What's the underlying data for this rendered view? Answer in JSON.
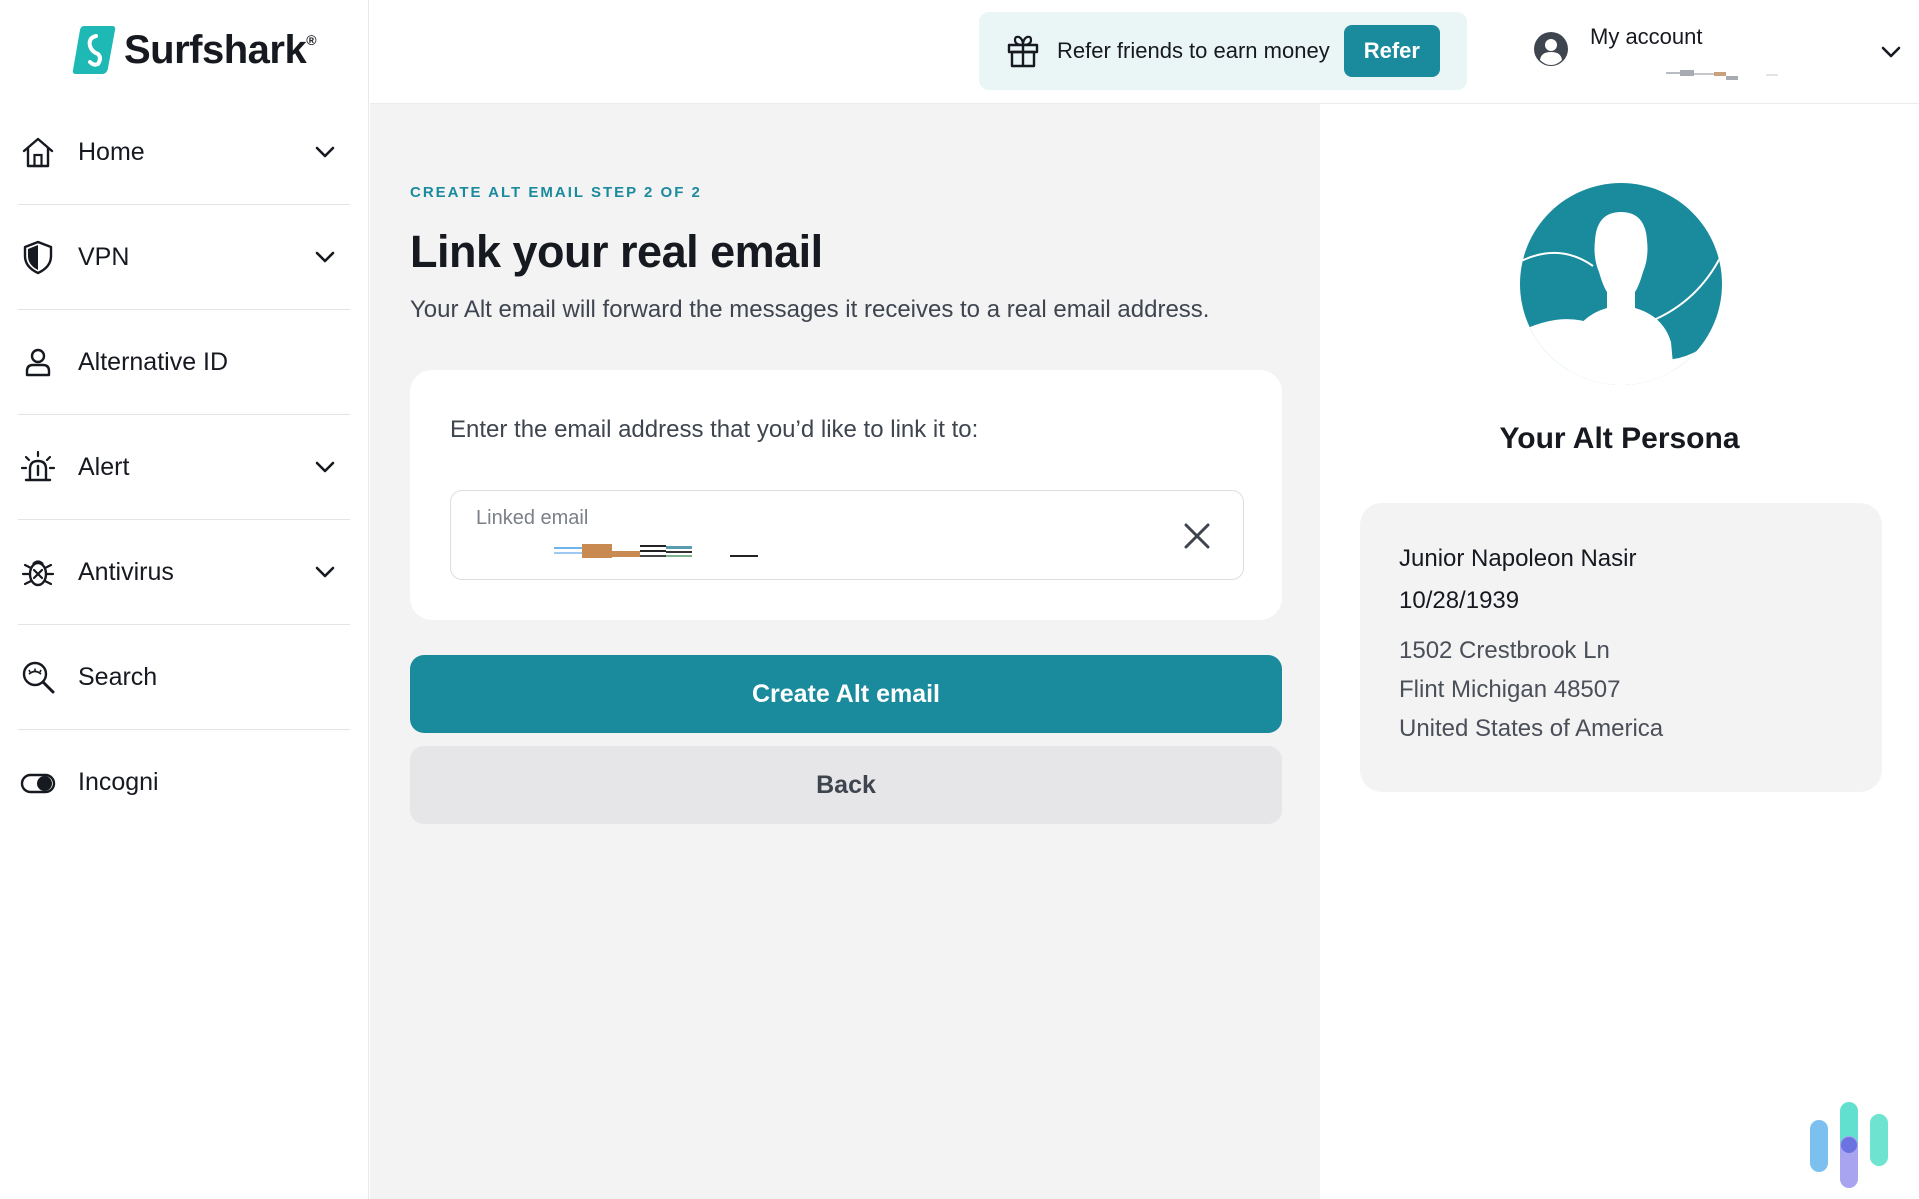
{
  "brand": {
    "name": "Surfshark",
    "registered": "®",
    "accent": "#1a8a9d"
  },
  "sidebar": {
    "items": [
      {
        "label": "Home",
        "icon": "home-icon",
        "has_chevron": true
      },
      {
        "label": "VPN",
        "icon": "shield-icon",
        "has_chevron": true
      },
      {
        "label": "Alternative ID",
        "icon": "person-icon",
        "has_chevron": false
      },
      {
        "label": "Alert",
        "icon": "alarm-icon",
        "has_chevron": true
      },
      {
        "label": "Antivirus",
        "icon": "bug-icon",
        "has_chevron": true
      },
      {
        "label": "Search",
        "icon": "search-icon",
        "has_chevron": false
      },
      {
        "label": "Incogni",
        "icon": "toggle-icon",
        "has_chevron": false
      }
    ]
  },
  "header": {
    "refer_text": "Refer friends to earn money",
    "refer_button": "Refer",
    "account_label": "My account"
  },
  "main": {
    "step_label": "CREATE ALT EMAIL STEP 2 OF 2",
    "title": "Link your real email",
    "subtitle": "Your Alt email will forward the messages it receives to a real email address.",
    "card_prompt": "Enter the email address that you’d like to link it to:",
    "email_field_label": "Linked email",
    "primary_button": "Create Alt email",
    "secondary_button": "Back"
  },
  "persona": {
    "title": "Your Alt Persona",
    "name": "Junior Napoleon Nasir",
    "dob": "10/28/1939",
    "address_line1": "1502 Crestbrook Ln",
    "address_line2": "Flint Michigan 48507",
    "address_line3": "United States of America"
  }
}
